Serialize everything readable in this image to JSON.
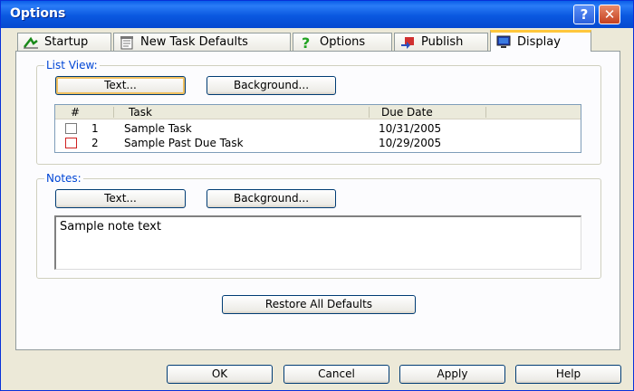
{
  "window": {
    "title": "Options"
  },
  "tabs": [
    {
      "label": "Startup"
    },
    {
      "label": "New Task Defaults"
    },
    {
      "label": "Options"
    },
    {
      "label": "Publish"
    },
    {
      "label": "Display"
    }
  ],
  "list_view": {
    "legend": "List View:",
    "text_button": "Text...",
    "background_button": "Background...",
    "columns": [
      "#",
      "Task",
      "Due Date"
    ],
    "rows": [
      {
        "num": "1",
        "task": "Sample Task",
        "due": "10/31/2005",
        "past_due": false
      },
      {
        "num": "2",
        "task": "Sample Past Due Task",
        "due": "10/29/2005",
        "past_due": true
      }
    ]
  },
  "notes": {
    "legend": "Notes:",
    "text_button": "Text...",
    "background_button": "Background...",
    "sample_text": "Sample note text"
  },
  "restore_button": "Restore All Defaults",
  "footer": {
    "ok": "OK",
    "cancel": "Cancel",
    "apply": "Apply",
    "help": "Help"
  },
  "colors": {
    "title_bar": "#0a58e0",
    "legend": "#0046d5",
    "past_due": "#d02020",
    "active_tab_highlight": "#ffc73c"
  }
}
